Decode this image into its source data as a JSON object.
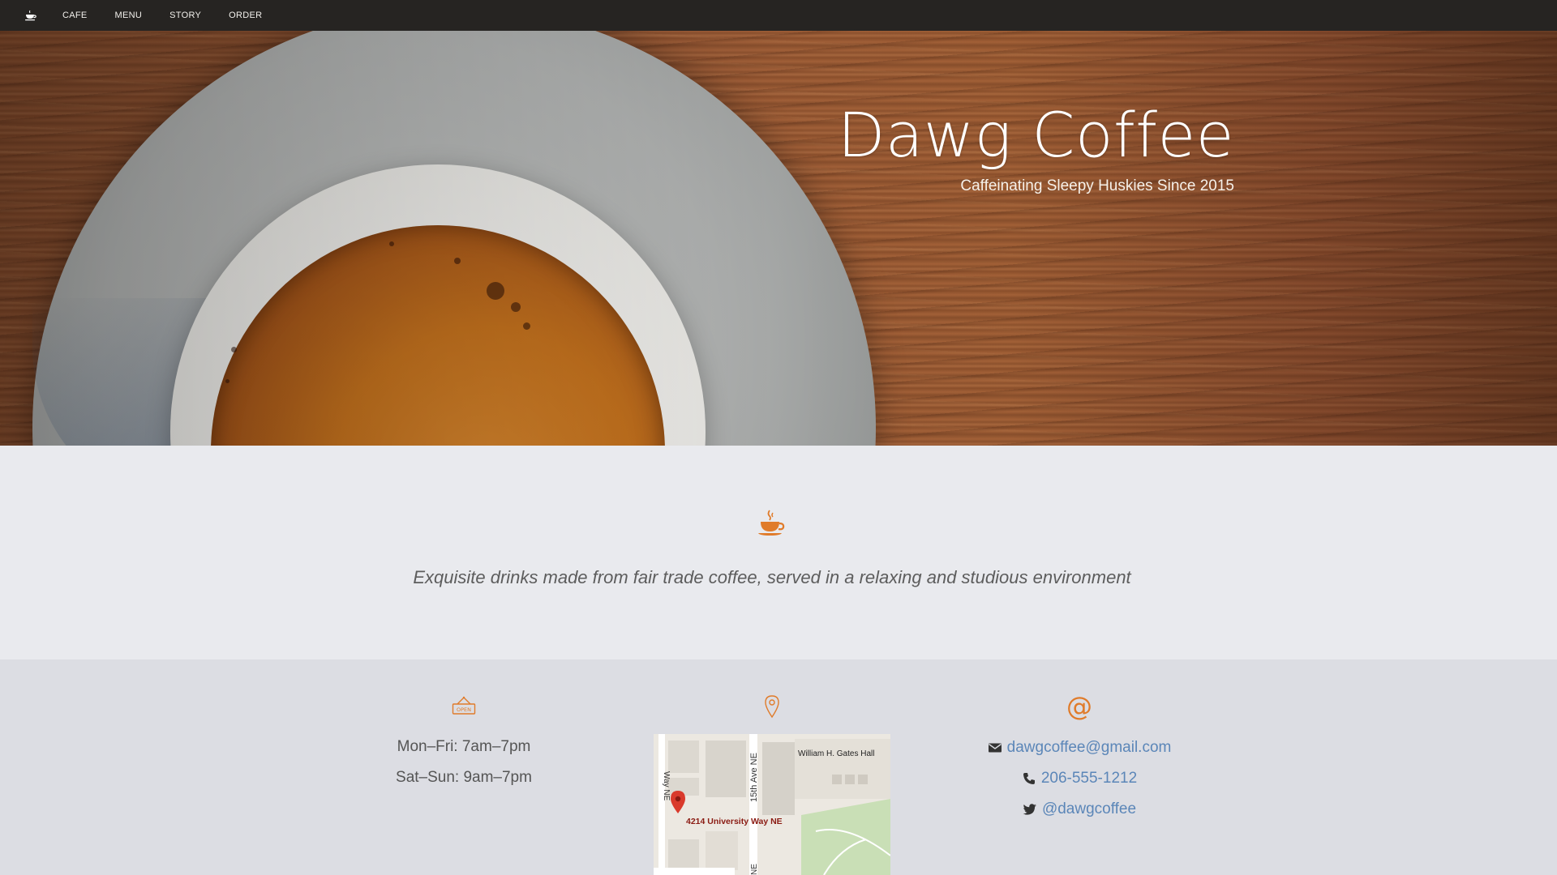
{
  "nav": {
    "logo_icon": "coffee-cup-icon",
    "links": [
      "CAFE",
      "MENU",
      "STORY",
      "ORDER"
    ]
  },
  "hero": {
    "title": "Dawg Coffee",
    "subtitle": "Caffeinating Sleepy Huskies Since 2015"
  },
  "intro": {
    "icon": "steaming-cup-icon",
    "tagline": "Exquisite drinks made from fair trade coffee, served in a relaxing and studious environment"
  },
  "hours": {
    "icon": "open-sign-icon",
    "sign_text": "OPEN",
    "lines": [
      "Mon–Fri: 7am–7pm",
      "Sat–Sun: 9am–7pm"
    ]
  },
  "location": {
    "icon": "map-pin-icon",
    "map": {
      "address": "4214 University Way NE",
      "building": "William H. Gates Hall",
      "street_1": "Way NE",
      "street_2": "15th Ave NE",
      "street_3": "NE"
    }
  },
  "contact": {
    "icon": "at-sign-icon",
    "email": "dawgcoffee@gmail.com",
    "phone": "206-555-1212",
    "twitter": "@dawgcoffee"
  },
  "colors": {
    "accent": "#e07b2a",
    "link": "#5b86b8",
    "nav_bg": "#262422"
  }
}
